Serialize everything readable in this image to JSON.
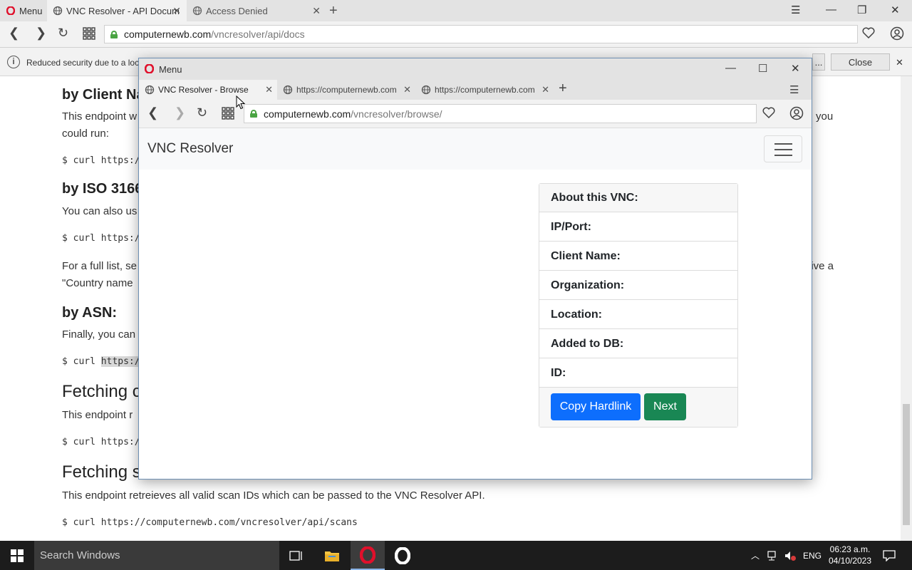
{
  "background_browser": {
    "menu_label": "Menu",
    "tabs": [
      {
        "label": "VNC Resolver - API Docum"
      },
      {
        "label": "Access Denied"
      }
    ],
    "url_host": "computernewb.com",
    "url_path": "/vncresolver/api/docs",
    "info_bar": {
      "text": "Reduced security due to a loc",
      "btn_partial": "...",
      "close_label": "Close"
    }
  },
  "doc": {
    "h_client": "by Client Na",
    "p_client": "This endpoint w",
    "p_client_right": "you",
    "p_client2": "could run:",
    "code_client": "$ curl https:/",
    "h_iso": "by ISO 3166",
    "p_iso": "You can also us",
    "code_iso": "$ curl https:/",
    "p_list": "For a full list, se",
    "p_list_right": "eive a",
    "p_list2": "\"Country name",
    "h_asn": "by ASN:",
    "p_asn": "Finally, you can",
    "code_asn_prefix": "$ curl ",
    "code_asn_hl": "https:/",
    "h_fetch1": "Fetching c",
    "p_fetch1": "This endpoint r",
    "code_fetch1": "$ curl https:/",
    "h_fetch2": "Fetching s",
    "p_fetch2": "This endpoint retreieves all valid scan IDs which can be passed to the VNC Resolver API.",
    "code_fetch2": "$ curl https://computernewb.com/vncresolver/api/scans"
  },
  "popup": {
    "title": "Menu",
    "tabs": [
      {
        "label": "VNC Resolver - Browse"
      },
      {
        "label": "https://computernewb.com"
      },
      {
        "label": "https://computernewb.com"
      }
    ],
    "url_host": "computernewb.com",
    "url_path": "/vncresolver/browse/",
    "brand": "VNC Resolver",
    "card": {
      "header": "About this VNC:",
      "rows": [
        "IP/Port:",
        "Client Name:",
        "Organization:",
        "Location:",
        "Added to DB:",
        "ID:"
      ],
      "copy_label": "Copy Hardlink",
      "next_label": "Next"
    }
  },
  "taskbar": {
    "search_placeholder": "Search Windows",
    "lang": "ENG",
    "time": "06:23 a.m.",
    "date": "04/10/2023"
  },
  "colors": {
    "primary_button": "#0d6efd",
    "success_button": "#198754",
    "secure_lock": "#4aa443",
    "opera_red": "#e0102b"
  }
}
